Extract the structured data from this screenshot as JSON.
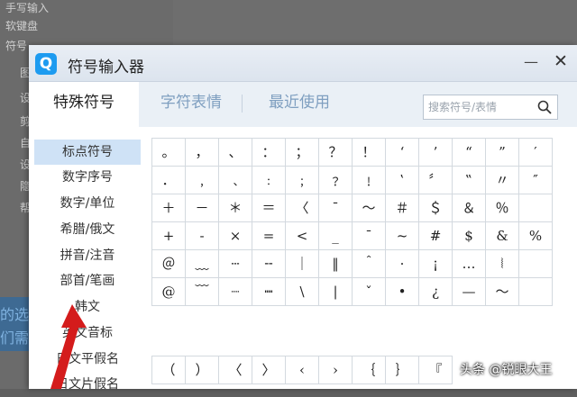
{
  "background": {
    "menu_items": [
      "手写输入",
      "软键盘",
      "符号",
      "图片",
      "设置",
      "剪贴",
      "自定",
      "设置",
      "隐藏",
      "帮助"
    ],
    "blue_text": [
      "的选",
      "们需"
    ]
  },
  "dialog": {
    "title": "符号输入器",
    "app_icon_letter": "Q",
    "minimize_glyph": "—",
    "close_glyph": "✕",
    "accent_color": "#1d9bf0"
  },
  "tabs": [
    {
      "label": "特殊符号",
      "active": true
    },
    {
      "label": "字符表情",
      "active": false
    },
    {
      "label": "最近使用",
      "active": false
    }
  ],
  "search": {
    "placeholder": "搜索符号/表情",
    "icon": "search-icon"
  },
  "sidebar": {
    "items": [
      {
        "label": "标点符号",
        "active": true
      },
      {
        "label": "数字序号",
        "active": false
      },
      {
        "label": "数字/单位",
        "active": false
      },
      {
        "label": "希腊/俄文",
        "active": false
      },
      {
        "label": "拼音/注音",
        "active": false
      },
      {
        "label": "部首/笔画",
        "active": false
      },
      {
        "label": "韩文",
        "active": false
      },
      {
        "label": "英文音标",
        "active": false
      },
      {
        "label": "日文平假名",
        "active": false
      },
      {
        "label": "日文片假名",
        "active": false
      }
    ]
  },
  "symbols": {
    "rows": [
      [
        "。",
        "，",
        "、",
        "：",
        "；",
        "？",
        "！",
        "‘",
        "’",
        "“",
        "”",
        "′"
      ],
      [
        "．",
        "﹐",
        "﹑",
        "﹕",
        "﹔",
        "﹖",
        "﹗",
        "‛",
        "〞",
        "‟",
        "〃",
        "″"
      ],
      [
        "＋",
        "－",
        "＊",
        "＝",
        "〈",
        "ˉ",
        "～",
        "＃",
        "＄",
        "＆",
        "％",
        ""
      ],
      [
        "+",
        "-",
        "×",
        "=",
        "<",
        "_",
        "¯",
        "~",
        "#",
        "$",
        "&",
        "%"
      ],
      [
        "＠",
        "﹏",
        "┄",
        "╌",
        "｜",
        "‖",
        "＾",
        "·",
        "¡",
        "…",
        "⦚",
        ""
      ],
      [
        "@",
        "﹋",
        "┈",
        "┉",
        "\\",
        "|",
        "ˇ",
        "•",
        "¿",
        "—",
        "〜",
        ""
      ]
    ],
    "bottom_row": [
      "（",
      "）",
      "〈",
      "〉",
      "‹",
      "›",
      "｛",
      "｝",
      "『"
    ]
  },
  "watermark": "头条 @锐眼大王"
}
